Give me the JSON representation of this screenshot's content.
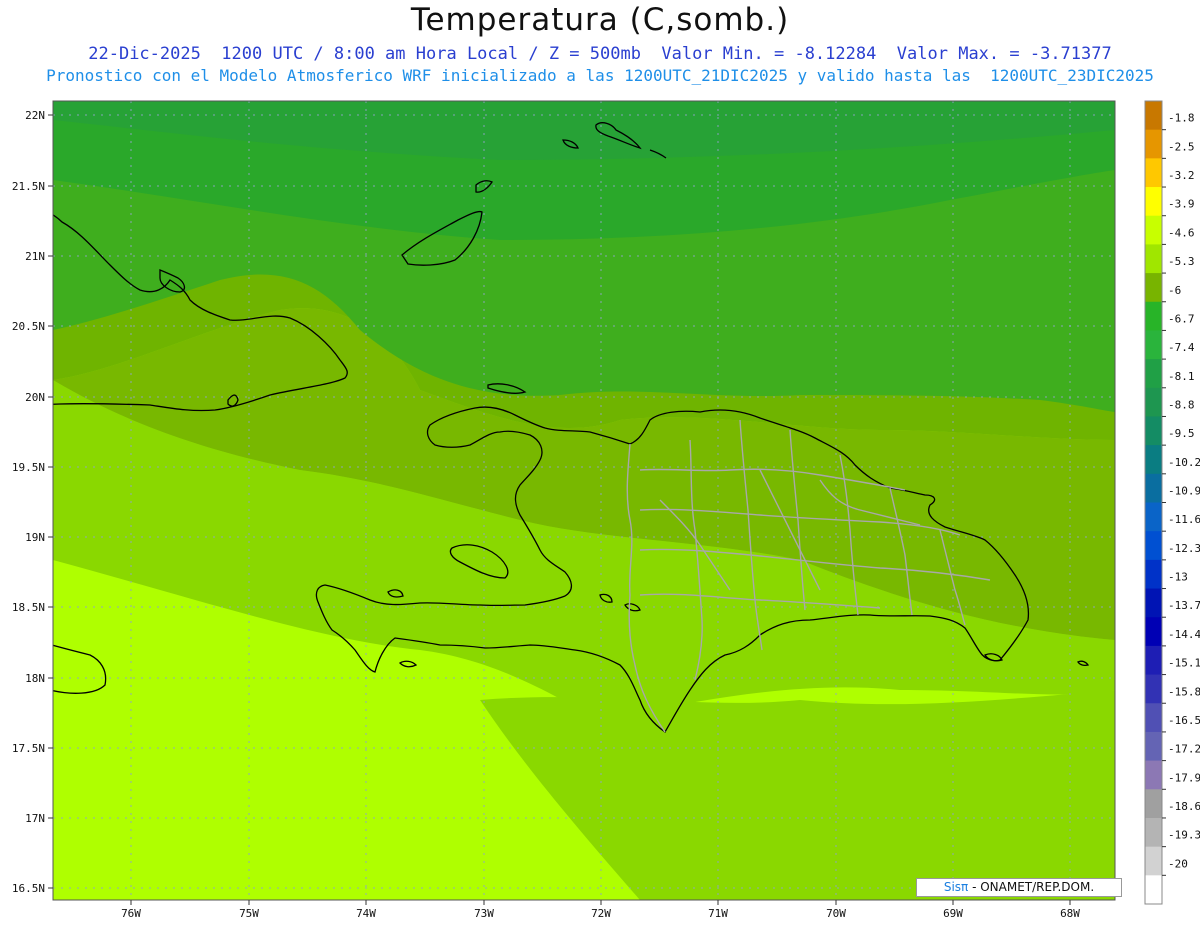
{
  "title": "Temperatura (C,somb.)",
  "subtitle_line1": "22-Dic-2025  1200 UTC / 8:00 am Hora Local / Z = 500mb  Valor Min. = -8.12284  Valor Max. = -3.71377",
  "subtitle_line2": "Pronostico con el Modelo Atmosferico WRF inicializado a las 1200UTC_21DIC2025 y valido hasta las  1200UTC_23DIC2025",
  "lat_labels": [
    "22N",
    "21.5N",
    "21N",
    "20.5N",
    "20N",
    "19.5N",
    "19N",
    "18.5N",
    "18N",
    "17.5N",
    "17N",
    "16.5N"
  ],
  "lon_labels": [
    "76W",
    "75W",
    "74W",
    "73W",
    "72W",
    "71W",
    "70W",
    "69W",
    "68W"
  ],
  "colorbar": {
    "labels": [
      "-1.8",
      "-2.5",
      "-3.2",
      "-3.9",
      "-4.6",
      "-5.3",
      "-6",
      "-6.7",
      "-7.4",
      "-8.1",
      "-8.8",
      "-9.5",
      "-10.2",
      "-10.9",
      "-11.6",
      "-12.3",
      "-13",
      "-13.7",
      "-14.4",
      "-15.1",
      "-15.8",
      "-16.5",
      "-17.2",
      "-17.9",
      "-18.6",
      "-19.3",
      "-20"
    ],
    "colors": [
      "#c87800",
      "#e69600",
      "#ffc800",
      "#ffff00",
      "#c8ff00",
      "#a0e600",
      "#78b400",
      "#28b428",
      "#2ab43c",
      "#20a046",
      "#1e9650",
      "#148c64",
      "#0a7d82",
      "#0a6ea0",
      "#0a64c8",
      "#0050d2",
      "#0032c8",
      "#0014b4",
      "#0000b4",
      "#1e1eb4",
      "#3232b4",
      "#5050b4",
      "#6464b4",
      "#8c78b4",
      "#a0a0a0",
      "#b4b4b4",
      "#d2d2d2",
      "#ffffff"
    ]
  },
  "credit_logo": "Sisπ",
  "credit_text": " - ONAMET/REP.DOM."
}
